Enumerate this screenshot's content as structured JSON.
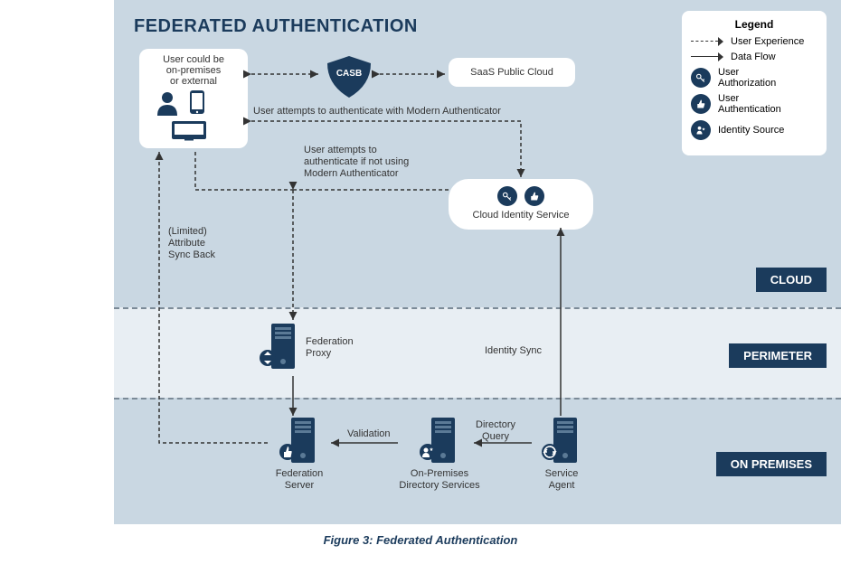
{
  "title": "FEDERATED AUTHENTICATION",
  "caption": "Figure 3: Federated Authentication",
  "zones": {
    "cloud": "CLOUD",
    "perimeter": "PERIMETER",
    "onprem": "ON PREMISES"
  },
  "legend": {
    "title": "Legend",
    "user_experience": "User Experience",
    "data_flow": "Data Flow",
    "user_authorization": "User\nAuthorization",
    "user_authentication": "User\nAuthentication",
    "identity_source": "Identity Source"
  },
  "nodes": {
    "user_box": "User could be\non-premises\nor external",
    "casb": "CASB",
    "saas": "SaaS Public Cloud",
    "cloud_identity": "Cloud Identity Service",
    "federation_proxy": "Federation\nProxy",
    "federation_server": "Federation\nServer",
    "onprem_directory": "On-Premises\nDirectory Services",
    "service_agent": "Service\nAgent"
  },
  "edges": {
    "modern_auth": "User attempts to authenticate with Modern Authenticator",
    "not_modern_auth": "User attempts to\nauthenticate if not using\nModern Authenticator",
    "attr_sync": "(Limited)\nAttribute\nSync Back",
    "identity_sync": "Identity Sync",
    "directory_query": "Directory\nQuery",
    "validation": "Validation"
  }
}
